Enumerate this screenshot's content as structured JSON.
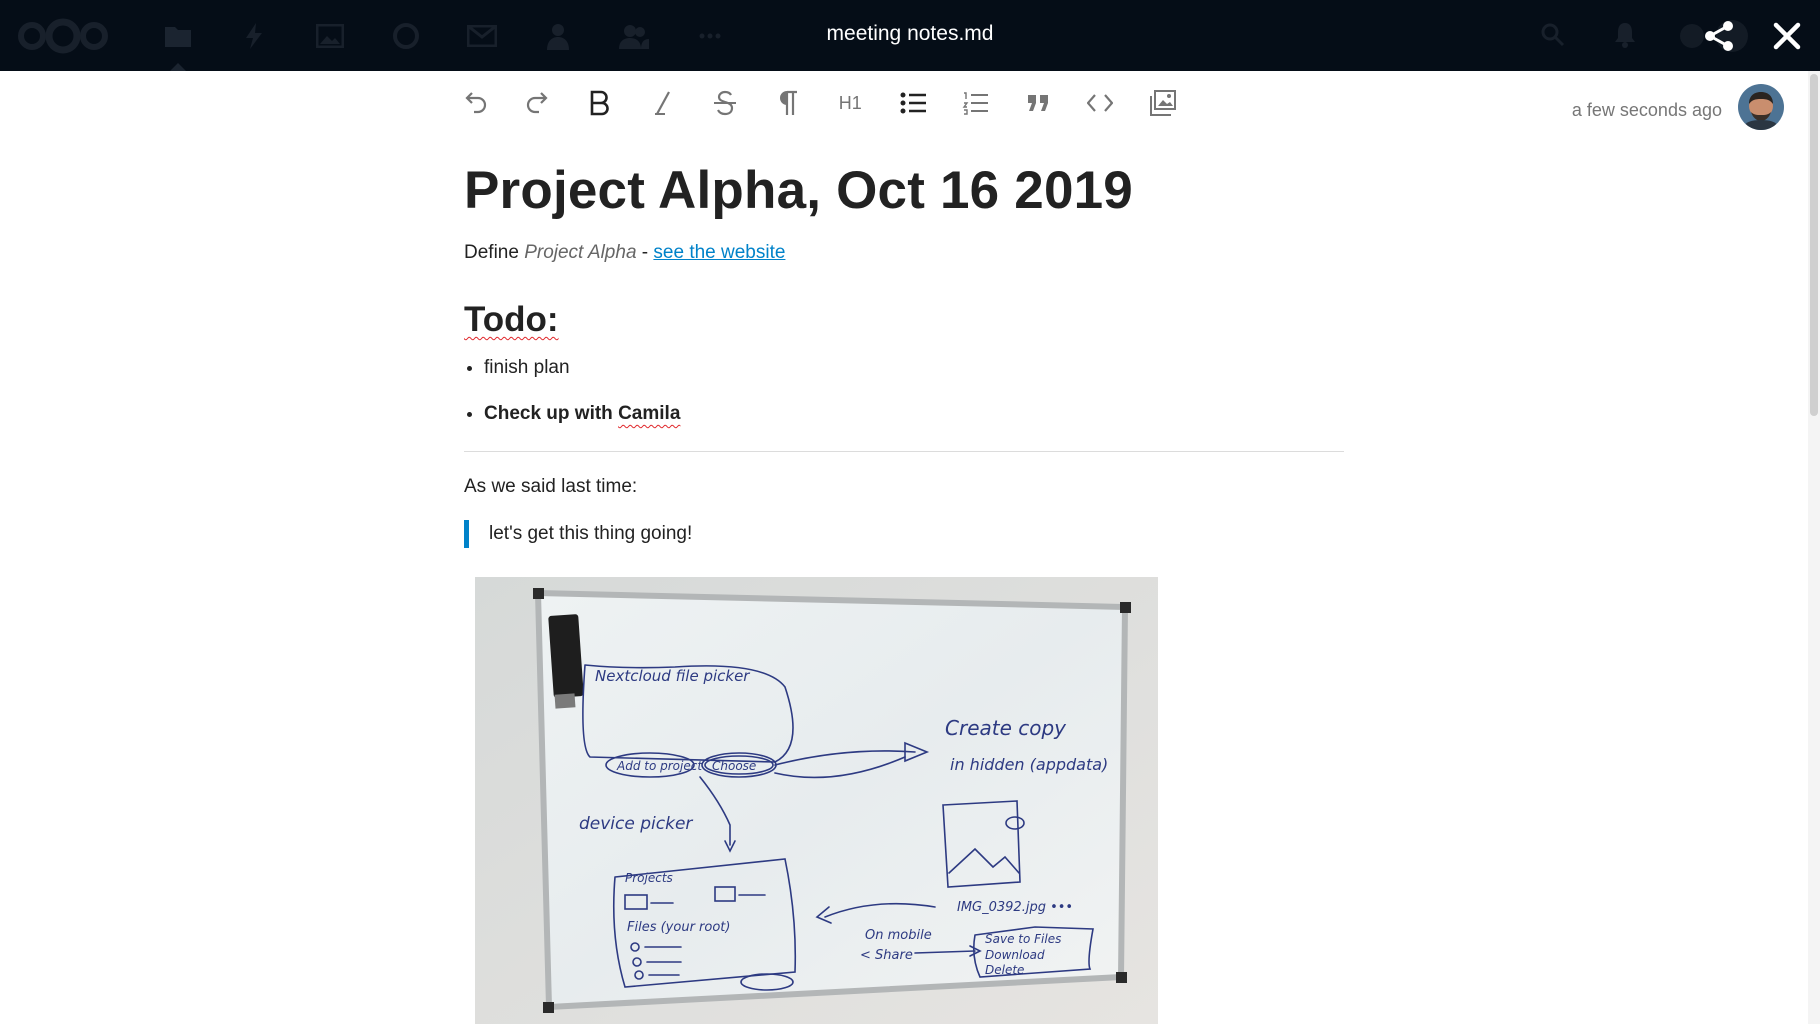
{
  "header": {
    "file_title": "meeting notes.md",
    "app_icons": [
      "files-icon",
      "activity-icon",
      "photos-icon",
      "talk-icon",
      "mail-icon",
      "contacts-icon",
      "circles-icon",
      "more-apps-icon"
    ],
    "active_app": "files-icon",
    "right_icons": [
      "search-icon",
      "notifications-icon",
      "user-menu-icon"
    ]
  },
  "toolbar": {
    "items": [
      "undo-icon",
      "redo-icon",
      "bold-icon",
      "italic-icon",
      "strikethrough-icon",
      "paragraph-icon",
      "heading-icon",
      "bullet-list-icon",
      "ordered-list-icon",
      "blockquote-icon",
      "code-icon",
      "image-icon"
    ],
    "heading_label": "H1"
  },
  "status": {
    "saved": "a few seconds ago"
  },
  "document": {
    "title": "Project Alpha, Oct 16 2019",
    "define_prefix": "Define ",
    "define_emphasis": "Project Alpha",
    "define_separator": " - ",
    "define_link": "see the website",
    "todo_heading": "Todo:",
    "todo_items": [
      {
        "text": "finish plan"
      },
      {
        "text_prefix": "Check up with ",
        "text_name": "Camila"
      }
    ],
    "said_text": "As we said last time:",
    "quote": "let's get this thing going!"
  },
  "whiteboard": {
    "texts": {
      "picker": "Nextcloud file picker",
      "add": "Add to project",
      "choose": "Choose",
      "create": "Create copy",
      "hidden": "in hidden (appdata)",
      "device": "device picker",
      "projects": "Projects",
      "files": "Files (your root)",
      "img": "IMG_0392.jpg •••",
      "onmobile": "On mobile",
      "share": "< Share",
      "savefiles": "Save to Files",
      "download": "Download",
      "delete": "Delete"
    }
  },
  "colors": {
    "header_bg": "#050d17",
    "accent": "#0082c9",
    "spell_error": "#e0262a"
  }
}
